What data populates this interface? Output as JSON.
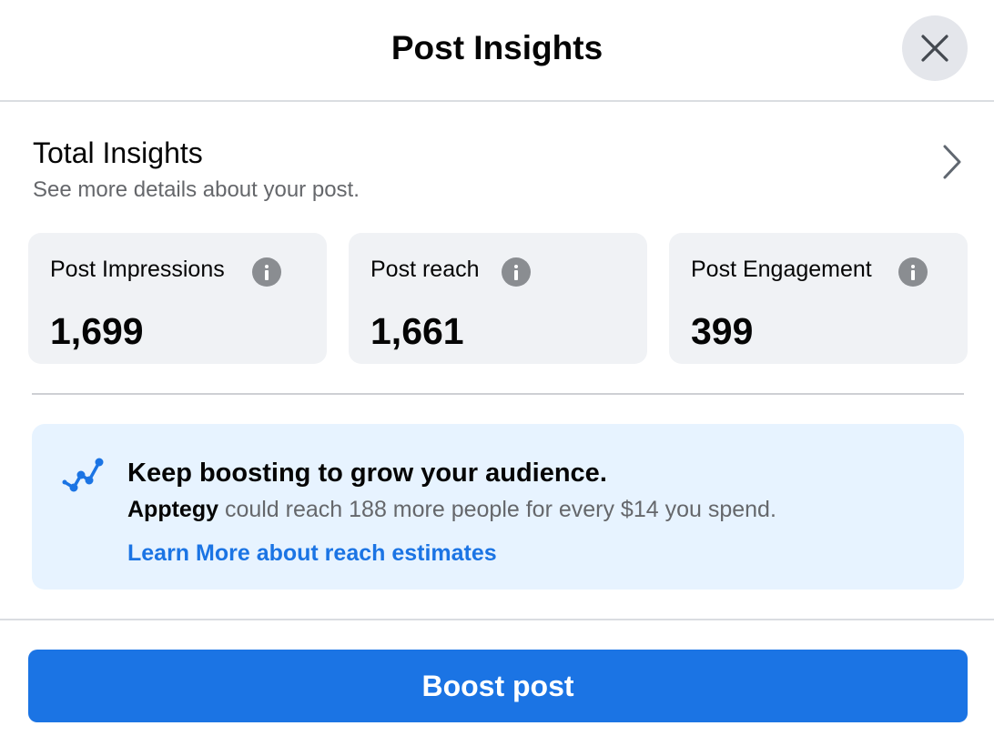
{
  "header": {
    "title": "Post Insights"
  },
  "total": {
    "title": "Total Insights",
    "subtitle": "See more details about your post."
  },
  "metrics": [
    {
      "label": "Post Impressions",
      "value": "1,699"
    },
    {
      "label": "Post reach",
      "value": "1,661"
    },
    {
      "label": "Post Engagement",
      "value": "399"
    }
  ],
  "promo": {
    "title": "Keep boosting to grow your audience.",
    "page_name": "Apptegy",
    "body_rest": " could reach 188 more people for every $14 you spend.",
    "link": "Learn More about reach estimates",
    "icon": "trend-line-icon"
  },
  "footer": {
    "boost_label": "Boost post"
  },
  "colors": {
    "accent": "#1b74e4",
    "card_bg": "#f0f2f5",
    "promo_bg": "#e7f3ff",
    "secondary_text": "#65676b"
  }
}
